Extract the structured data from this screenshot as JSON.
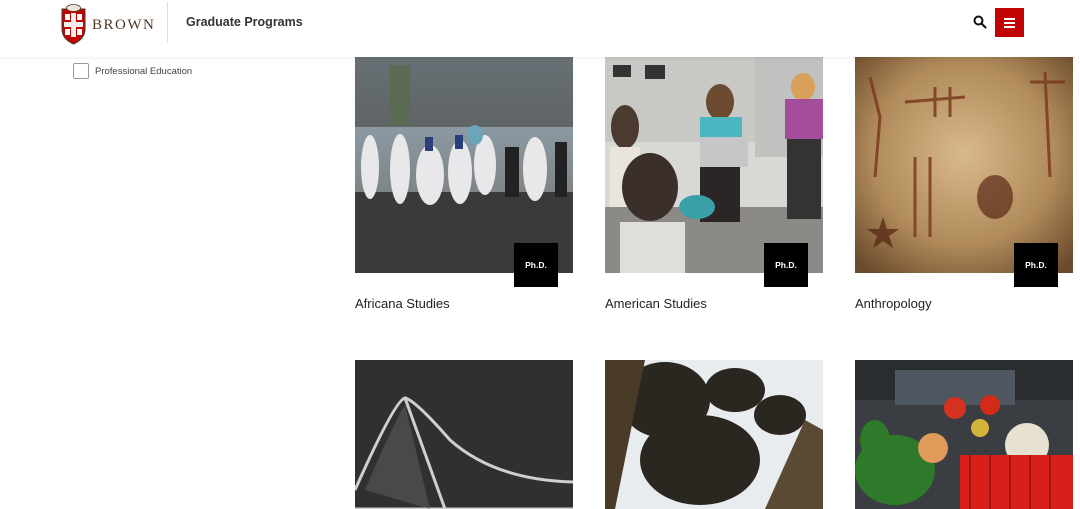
{
  "header": {
    "logo_text": "BROWN",
    "program_title": "Graduate Programs",
    "search_icon": "search-icon",
    "menu_icon": "hamburger-menu-icon",
    "menu_color": "#c00404"
  },
  "filters": {
    "items": [
      {
        "label": "Professional Education",
        "checked": false
      }
    ]
  },
  "programs": [
    {
      "title": "Africana Studies",
      "badge": "Ph.D."
    },
    {
      "title": "American Studies",
      "badge": "Ph.D."
    },
    {
      "title": "Anthropology",
      "badge": "Ph.D."
    },
    {
      "title": "",
      "badge": ""
    },
    {
      "title": "",
      "badge": ""
    },
    {
      "title": "",
      "badge": ""
    }
  ]
}
